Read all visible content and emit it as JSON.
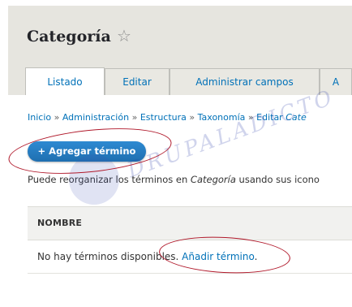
{
  "header": {
    "title": "Categoría",
    "tabs": [
      {
        "label": "Listado",
        "active": true
      },
      {
        "label": "Editar",
        "active": false
      },
      {
        "label": "Administrar campos",
        "active": false
      },
      {
        "label": "A",
        "active": false
      }
    ]
  },
  "breadcrumb": {
    "items": [
      "Inicio",
      "Administración",
      "Estructura",
      "Taxonomía",
      "Editar"
    ],
    "last": "Cate",
    "separator": "»"
  },
  "actions": {
    "add_button": "+ Agregar término"
  },
  "description": {
    "prefix": "Puede reorganizar los términos en ",
    "vocab": "Categoría",
    "suffix": " usando sus icono"
  },
  "table": {
    "header": "NOMBRE",
    "empty_text": "No hay términos disponibles. ",
    "empty_link": "Añadir término",
    "empty_period": "."
  },
  "watermark": "DRUPALADICTO",
  "colors": {
    "link": "#0071b8",
    "button": "#1e7fc8",
    "annotation": "#b0182a"
  }
}
